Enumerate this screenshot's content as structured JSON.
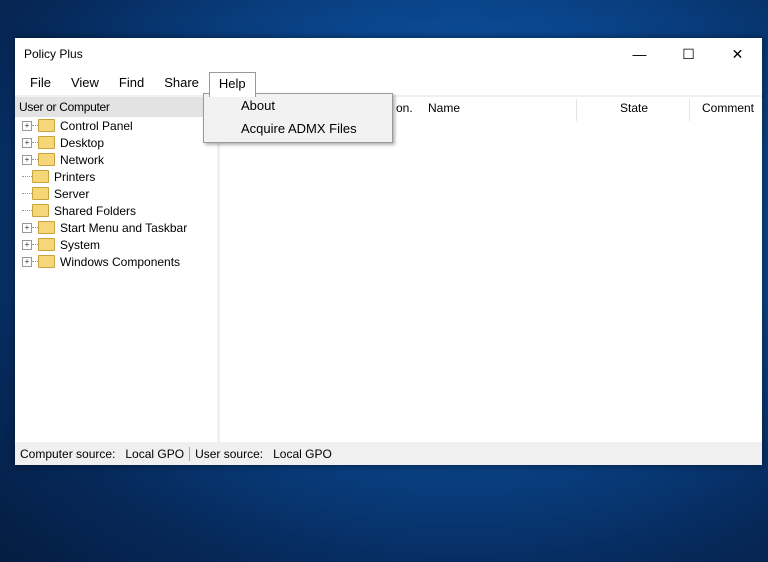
{
  "window": {
    "title": "Policy Plus",
    "minimize": "—",
    "maximize": "☐",
    "close": "✕"
  },
  "menu": [
    "File",
    "View",
    "Find",
    "Share",
    "Help"
  ],
  "help_menu": [
    "About",
    "Acquire ADMX Files"
  ],
  "left_pane": {
    "header": "User or Computer",
    "nodes": [
      {
        "label": "Control Panel",
        "expandable": true
      },
      {
        "label": "Desktop",
        "expandable": true
      },
      {
        "label": "Network",
        "expandable": true
      },
      {
        "label": "Printers",
        "expandable": false
      },
      {
        "label": "Server",
        "expandable": false
      },
      {
        "label": "Shared Folders",
        "expandable": false
      },
      {
        "label": "Start Menu and Taskbar",
        "expandable": true
      },
      {
        "label": "System",
        "expandable": true
      },
      {
        "label": "Windows Components",
        "expandable": true
      }
    ]
  },
  "columns": {
    "partial": "on.",
    "name": "Name",
    "state": "State",
    "comment": "Comment"
  },
  "status": {
    "computer_label": "Computer source:",
    "computer_value": "Local GPO",
    "user_label": "User source:",
    "user_value": "Local GPO"
  }
}
